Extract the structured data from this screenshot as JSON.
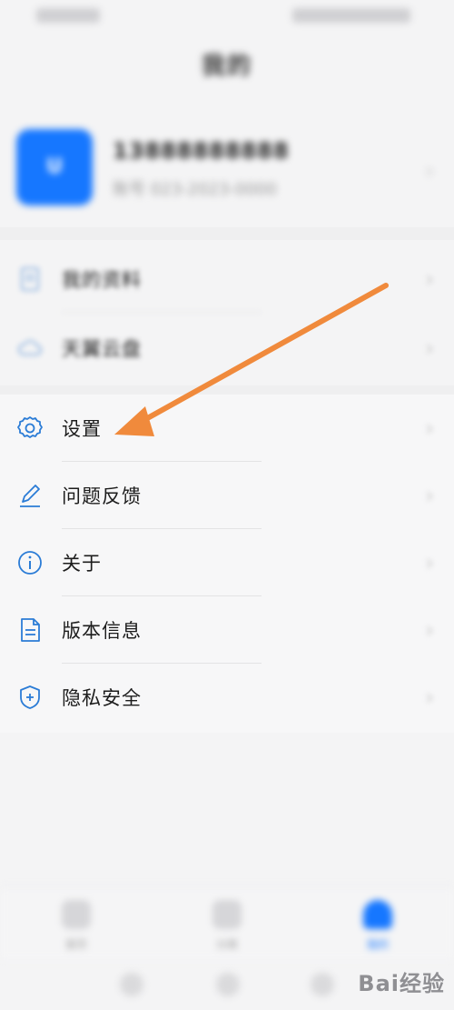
{
  "page": {
    "title": "我的"
  },
  "profile": {
    "name": "13888888888",
    "account": "账号 023-2023-0000",
    "avatar_text": "U"
  },
  "menu_top": [
    {
      "label": "我的资料",
      "icon": "document-icon"
    },
    {
      "label": "天翼云盘",
      "icon": "cloud-icon"
    }
  ],
  "menu": [
    {
      "label": "设置",
      "icon": "gear-icon"
    },
    {
      "label": "问题反馈",
      "icon": "pencil-icon"
    },
    {
      "label": "关于",
      "icon": "info-icon"
    },
    {
      "label": "版本信息",
      "icon": "document-icon"
    },
    {
      "label": "隐私安全",
      "icon": "shield-plus-icon"
    }
  ],
  "chevron": "›",
  "colors": {
    "icon_blue": "#2b7cd6",
    "accent": "#1677ff",
    "arrow": "#f08a3c"
  },
  "bottom_nav": [
    {
      "label": "首页"
    },
    {
      "label": "分类"
    },
    {
      "label": "我的",
      "active": true
    }
  ],
  "watermark": "Bai经验"
}
